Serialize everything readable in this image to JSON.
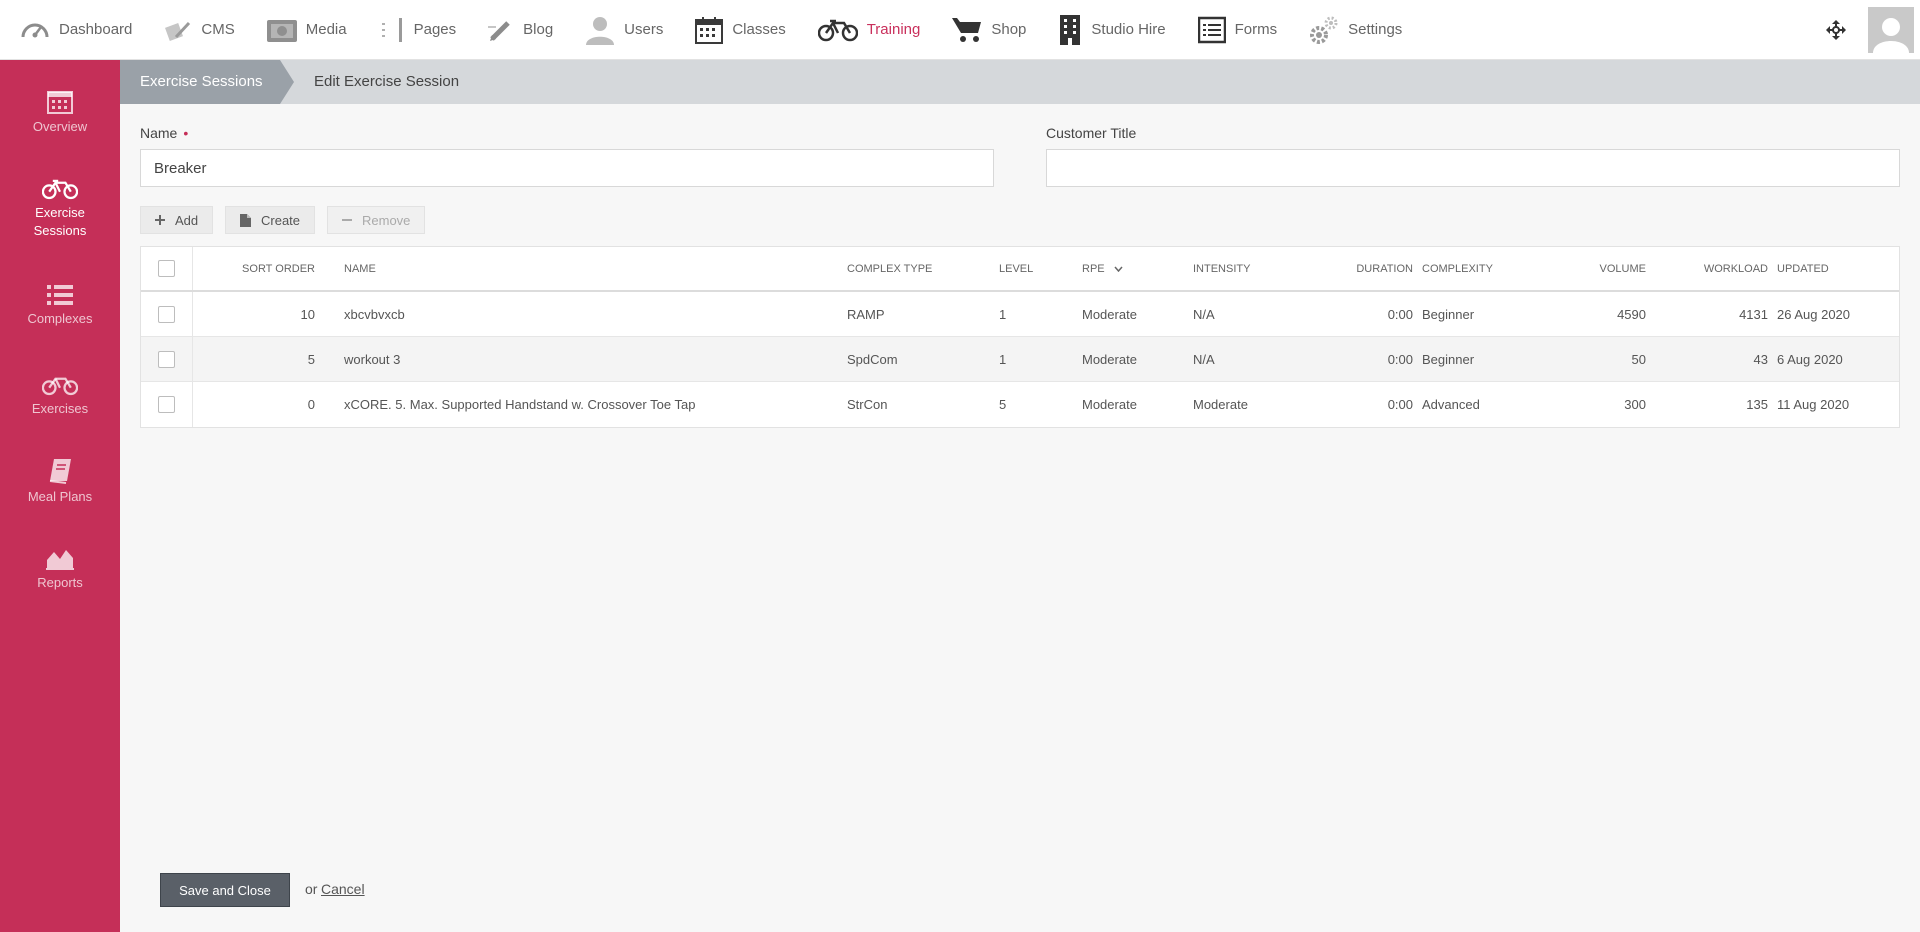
{
  "topnav": {
    "items": [
      {
        "label": "Dashboard",
        "icon": "speedometer-icon"
      },
      {
        "label": "CMS",
        "icon": "cms-icon"
      },
      {
        "label": "Media",
        "icon": "media-icon"
      },
      {
        "label": "Pages",
        "icon": "pages-icon"
      },
      {
        "label": "Blog",
        "icon": "pencil-icon"
      },
      {
        "label": "Users",
        "icon": "user-icon"
      },
      {
        "label": "Classes",
        "icon": "calendar-icon"
      },
      {
        "label": "Training",
        "icon": "bicycle-icon",
        "active": true
      },
      {
        "label": "Shop",
        "icon": "cart-icon"
      },
      {
        "label": "Studio Hire",
        "icon": "building-icon"
      },
      {
        "label": "Forms",
        "icon": "form-icon"
      },
      {
        "label": "Settings",
        "icon": "gears-icon"
      }
    ],
    "active_color": "#c9305c"
  },
  "sidebar": {
    "color": "#c52f58",
    "items": [
      {
        "label": "Overview",
        "icon": "calendar-icon"
      },
      {
        "label": "Exercise Sessions",
        "icon": "bicycle-icon",
        "active": true
      },
      {
        "label": "Complexes",
        "icon": "list-icon"
      },
      {
        "label": "Exercises",
        "icon": "bicycle-icon"
      },
      {
        "label": "Meal Plans",
        "icon": "book-icon"
      },
      {
        "label": "Reports",
        "icon": "area-chart-icon"
      }
    ]
  },
  "breadcrumb": {
    "parent": "Exercise Sessions",
    "current": "Edit Exercise Session"
  },
  "form": {
    "name_label": "Name",
    "required_marker": "•",
    "name_value": "Breaker",
    "customer_title_label": "Customer Title",
    "customer_title_value": ""
  },
  "toolbar": {
    "add_label": "Add",
    "create_label": "Create",
    "remove_label": "Remove"
  },
  "table": {
    "columns": {
      "sort_order": "SORT ORDER",
      "name": "NAME",
      "complex_type": "COMPLEX TYPE",
      "level": "LEVEL",
      "rpe": "RPE",
      "intensity": "INTENSITY",
      "duration": "DURATION",
      "complexity": "COMPLEXITY",
      "volume": "VOLUME",
      "workload": "WORKLOAD",
      "updated": "UPDATED"
    },
    "sorted_column": "rpe",
    "rows": [
      {
        "sort_order": "10",
        "name": "xbcvbvxcb",
        "complex_type": "RAMP",
        "level": "1",
        "rpe": "Moderate",
        "intensity": "N/A",
        "duration": "0:00",
        "complexity": "Beginner",
        "volume": "4590",
        "workload": "4131",
        "updated": "26 Aug 2020"
      },
      {
        "sort_order": "5",
        "name": "workout 3",
        "complex_type": "SpdCom",
        "level": "1",
        "rpe": "Moderate",
        "intensity": "N/A",
        "duration": "0:00",
        "complexity": "Beginner",
        "volume": "50",
        "workload": "43",
        "updated": "6 Aug 2020"
      },
      {
        "sort_order": "0",
        "name": "xCORE. 5. Max. Supported Handstand w. Crossover Toe Tap",
        "complex_type": "StrCon",
        "level": "5",
        "rpe": "Moderate",
        "intensity": "Moderate",
        "duration": "0:00",
        "complexity": "Advanced",
        "volume": "300",
        "workload": "135",
        "updated": "11 Aug 2020"
      }
    ]
  },
  "footer": {
    "save_label": "Save and Close",
    "or_text": "or",
    "cancel_label": "Cancel"
  }
}
